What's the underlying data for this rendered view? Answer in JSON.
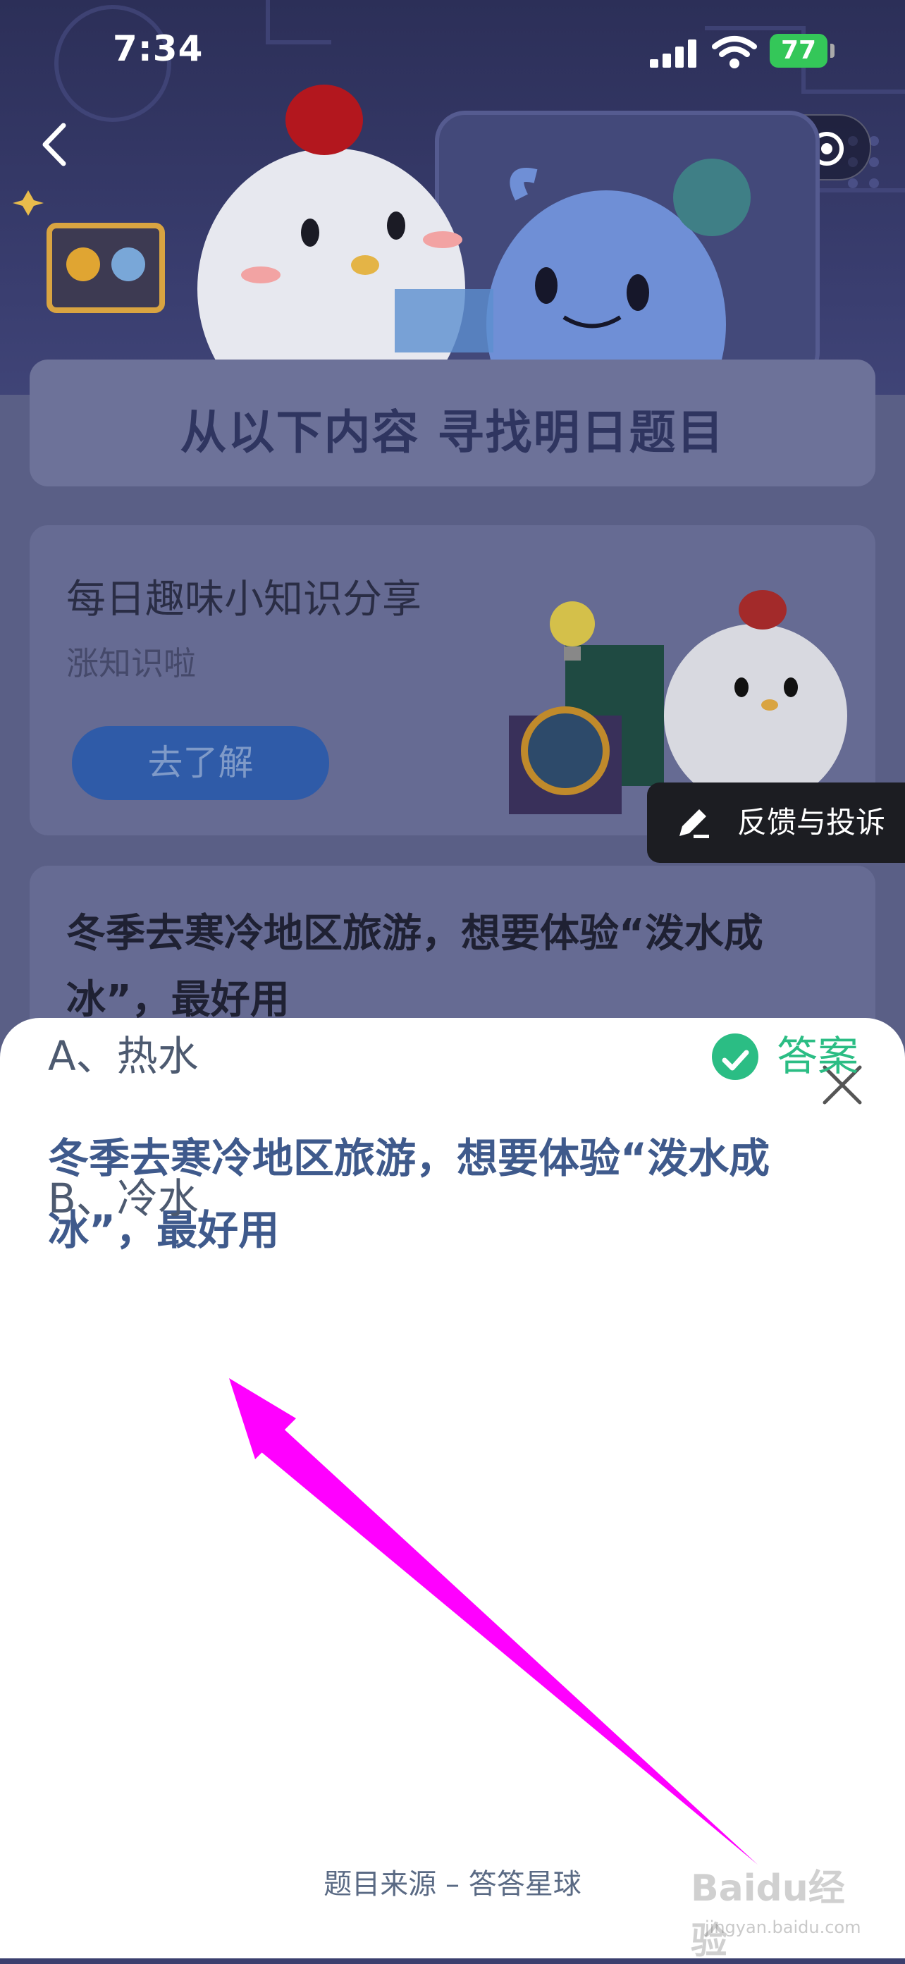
{
  "status_bar": {
    "time": "7:34",
    "battery": "77"
  },
  "background": {
    "heading": "从以下内容  寻找明日题目",
    "card": {
      "title": "每日趣味小知识分享",
      "subtitle": "涨知识啦",
      "button": "去了解"
    },
    "feedback_label": "反馈与投诉",
    "question_preview": "冬季去寒冷地区旅游，想要体验“泼水成冰”，最好用"
  },
  "sheet": {
    "question": "冬季去寒冷地区旅游，想要体验“泼水成冰”，最好用",
    "options": [
      {
        "label": "A、热水",
        "is_answer": true
      },
      {
        "label": "B、冷水",
        "is_answer": false
      }
    ],
    "answer_label": "答案",
    "footer": "题目来源 – 答答星球"
  },
  "watermark": {
    "text": "Baidu经验",
    "sub": "jingyan.baidu.com"
  },
  "colors": {
    "accent_green": "#2bbd84",
    "question_blue": "#3f5a8c",
    "arrow_magenta": "#ff00ff",
    "button_blue": "#2f5ba8"
  }
}
